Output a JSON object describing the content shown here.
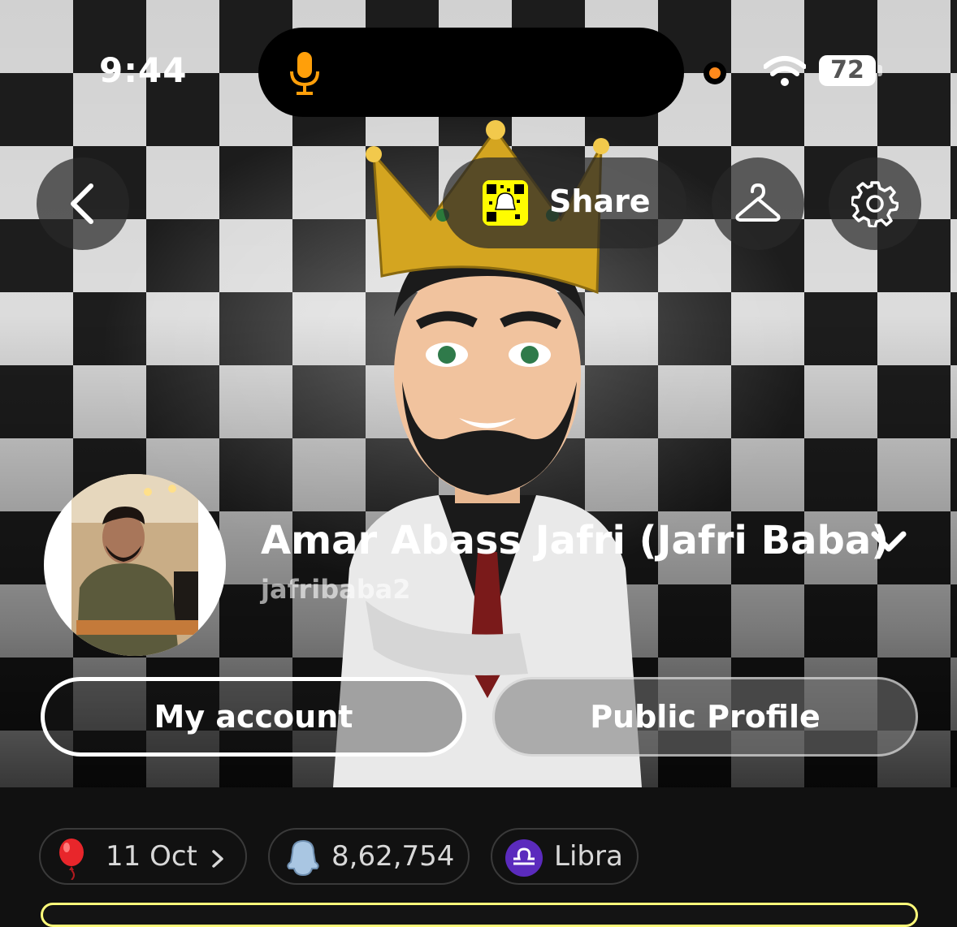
{
  "status_bar": {
    "time": "9:44",
    "battery": "72"
  },
  "header": {
    "share_label": "Share"
  },
  "profile": {
    "display_name": "Amar Abass Jafri (Jafri Baba)",
    "username": "jafribaba2"
  },
  "buttons": {
    "my_account": "My account",
    "public_profile": "Public Profile"
  },
  "chips": [
    {
      "icon": "balloon-icon",
      "label": "11 Oct"
    },
    {
      "icon": "snap-score-ghost-icon",
      "label": "8,62,754"
    },
    {
      "icon": "libra-zodiac-icon",
      "label": "Libra"
    }
  ],
  "colors": {
    "snap_yellow": "#fffc00",
    "mic_orange": "#ff9f0a",
    "libra_purple": "#5b2bbd"
  }
}
